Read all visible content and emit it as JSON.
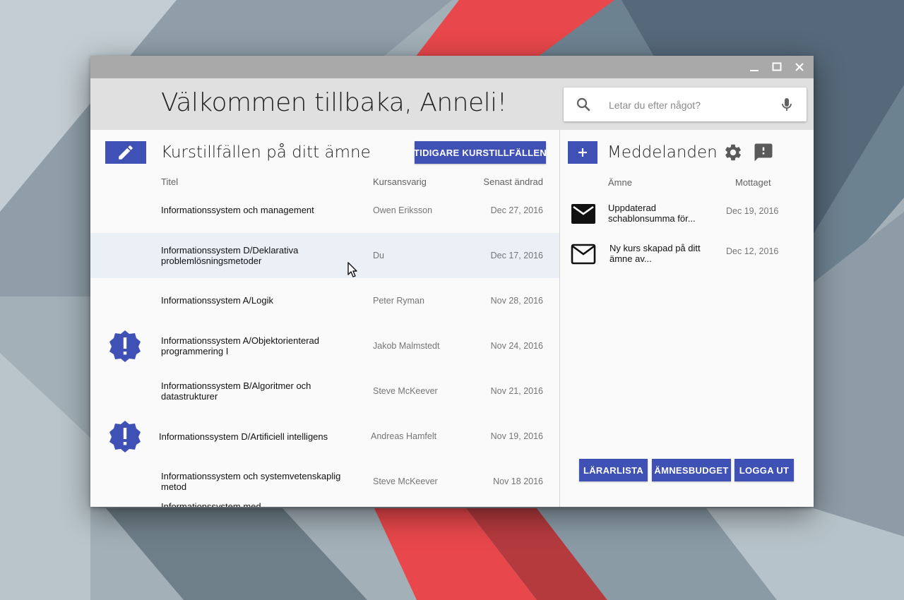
{
  "window": {
    "controls": [
      "minimize-icon",
      "maximize-icon",
      "close-icon"
    ]
  },
  "header": {
    "welcome": "Välkommen tillbaka, Anneli!",
    "search_placeholder": "Letar du efter något?"
  },
  "courses": {
    "title": "Kurstillfällen på ditt ämne",
    "previous_button": "TIDIGARE KURSTILLFÄLLEN",
    "columns": {
      "title": "Titel",
      "responsible": "Kursansvarig",
      "modified": "Senast ändrad"
    },
    "rows": [
      {
        "title": "Informationssystem och management",
        "responsible": "Owen Eriksson",
        "modified": "Dec 27, 2016",
        "alert": false
      },
      {
        "title": "Informationssystem D/Deklarativa problemlösningsmetoder",
        "responsible": "Du",
        "modified": "Dec 17, 2016",
        "alert": false,
        "highlighted": true
      },
      {
        "title": "Informationssystem A/Logik",
        "responsible": "Peter Ryman",
        "modified": "Nov 28, 2016",
        "alert": false
      },
      {
        "title": "Informationssystem A/Objektorienterad programmering I",
        "responsible": "Jakob Malmstedt",
        "modified": "Nov 24, 2016",
        "alert": true
      },
      {
        "title": "Informationssystem B/Algoritmer och datastrukturer",
        "responsible": "Steve McKeever",
        "modified": "Nov 21, 2016",
        "alert": false
      },
      {
        "title": "Informationssystem D/Artificiell intelligens",
        "responsible": "Andreas Hamfelt",
        "modified": "Nov 19, 2016",
        "alert": true
      },
      {
        "title": "Informationssystem och systemvetenskaplig metod",
        "responsible": "Steve McKeever",
        "modified": "Nov 18 2016",
        "alert": false
      },
      {
        "title": "Informationssystem med",
        "responsible": "",
        "modified": "",
        "alert": false
      }
    ],
    "fab_label": "+"
  },
  "messages": {
    "add_label": "+",
    "title": "Meddelanden",
    "columns": {
      "subject": "Ämne",
      "received": "Mottaget"
    },
    "rows": [
      {
        "subject": "Uppdaterad schablonsumma för...",
        "received": "Dec 19, 2016",
        "read": false
      },
      {
        "subject": "Ny kurs skapad på ditt ämne av...",
        "received": "Dec 12, 2016",
        "read": true
      }
    ]
  },
  "footer_buttons": {
    "teachers": "LÄRARLISTA",
    "budget": "ÄMNESBUDGET",
    "logout": "LOGGA UT"
  },
  "colors": {
    "primary": "#3f51b5",
    "header_bg": "#e0e0e0",
    "titlebar_bg": "#a9a9a9",
    "highlight_row": "#ebeff6",
    "wallpaper_accent": "#e8474b"
  }
}
